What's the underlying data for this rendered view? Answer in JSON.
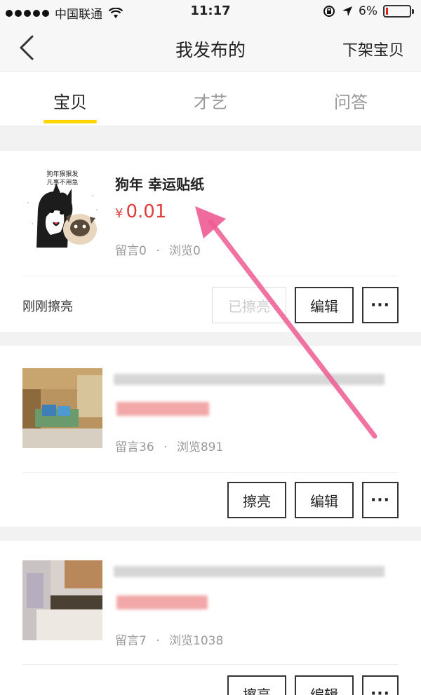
{
  "status_bar": {
    "carrier": "中国联通",
    "time": "11:17",
    "battery": "6%",
    "battery_level": 0.06,
    "colors": {
      "battery_low": "#e0241b"
    }
  },
  "nav": {
    "title": "我发布的",
    "right_action": "下架宝贝",
    "back_icon": "chevron-left-icon"
  },
  "tabs": [
    {
      "label": "宝贝",
      "active": true
    },
    {
      "label": "才艺",
      "active": false
    },
    {
      "label": "问答",
      "active": false
    }
  ],
  "listings": [
    {
      "title": "狗年 幸运贴纸",
      "currency": "¥",
      "price": "0.01",
      "comments": "留言0",
      "views": "浏览0",
      "status_note": "刚刚擦亮",
      "buttons": {
        "polish": "已擦亮",
        "edit": "编辑",
        "more": "···"
      },
      "thumb_text": [
        "狗年狠狠发",
        "凡事不用急"
      ]
    },
    {
      "comments": "留言36",
      "views": "浏览891",
      "buttons": {
        "polish": "擦亮",
        "edit": "编辑",
        "more": "···"
      }
    },
    {
      "comments": "留言7",
      "views": "浏览1038",
      "buttons": {
        "polish": "擦亮",
        "edit": "编辑",
        "more": "···"
      }
    }
  ],
  "separator": "·",
  "colors": {
    "accent": "#ffd400",
    "price": "#e23b3b",
    "annotation_arrow": "#ee5b92"
  }
}
